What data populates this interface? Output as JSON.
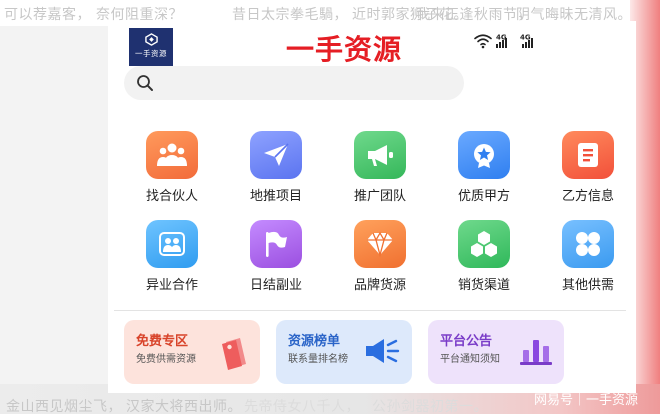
{
  "danmaku_top": [
    "可以荐嘉客，",
    "奈何阻重深？",
    "昔日太宗拳毛騧，",
    "近时郭家狮子花。",
    "我来正逢秋雨节，",
    "阴气晦昧无清风。"
  ],
  "danmaku_bottom": [
    "金山西见烟尘飞，",
    "汉家大将西出师。",
    "先帝侍女八千人，",
    "公孙剑器初第一。"
  ],
  "header": {
    "logo_text": "一手资源",
    "title": "一手资源"
  },
  "status_bar": {
    "network_1": "4G",
    "network_2": "4G"
  },
  "colors": {
    "brand_red": "#e51e24",
    "logo_navy": "#1f3170"
  },
  "grid": [
    {
      "label": "找合伙人",
      "icon": "team-icon",
      "color": "#f26b3a"
    },
    {
      "label": "地推项目",
      "icon": "paper-plane-icon",
      "color": "#5b74f0"
    },
    {
      "label": "推广团队",
      "icon": "megaphone-icon",
      "color": "#35b75a"
    },
    {
      "label": "优质甲方",
      "icon": "star-badge-icon",
      "color": "#2f7ff0"
    },
    {
      "label": "乙方信息",
      "icon": "document-icon",
      "color": "#f2503a"
    },
    {
      "label": "异业合作",
      "icon": "people-icon",
      "color": "#2f9cf0"
    },
    {
      "label": "日结副业",
      "icon": "flag-icon",
      "color": "#9b4fe0"
    },
    {
      "label": "品牌货源",
      "icon": "diamond-icon",
      "color": "#f07030"
    },
    {
      "label": "销货渠道",
      "icon": "hexagon-cluster-icon",
      "color": "#2fb85a"
    },
    {
      "label": "其他供需",
      "icon": "grid-dots-icon",
      "color": "#3a9af0"
    }
  ],
  "cards": [
    {
      "title": "免费专区",
      "subtitle": "免费供需资源",
      "bg": "#fde3dc",
      "title_color": "#d8432a",
      "icon": "price-tag-icon"
    },
    {
      "title": "资源榜单",
      "subtitle": "联系量排名榜",
      "bg": "#dde9fb",
      "title_color": "#2a64c8",
      "icon": "loudspeaker-icon"
    },
    {
      "title": "平台公告",
      "subtitle": "平台通知须知",
      "bg": "#eee2fb",
      "title_color": "#7a3cc8",
      "icon": "bar-chart-icon"
    }
  ],
  "footer": {
    "brand": "网易号｜一手资源"
  }
}
